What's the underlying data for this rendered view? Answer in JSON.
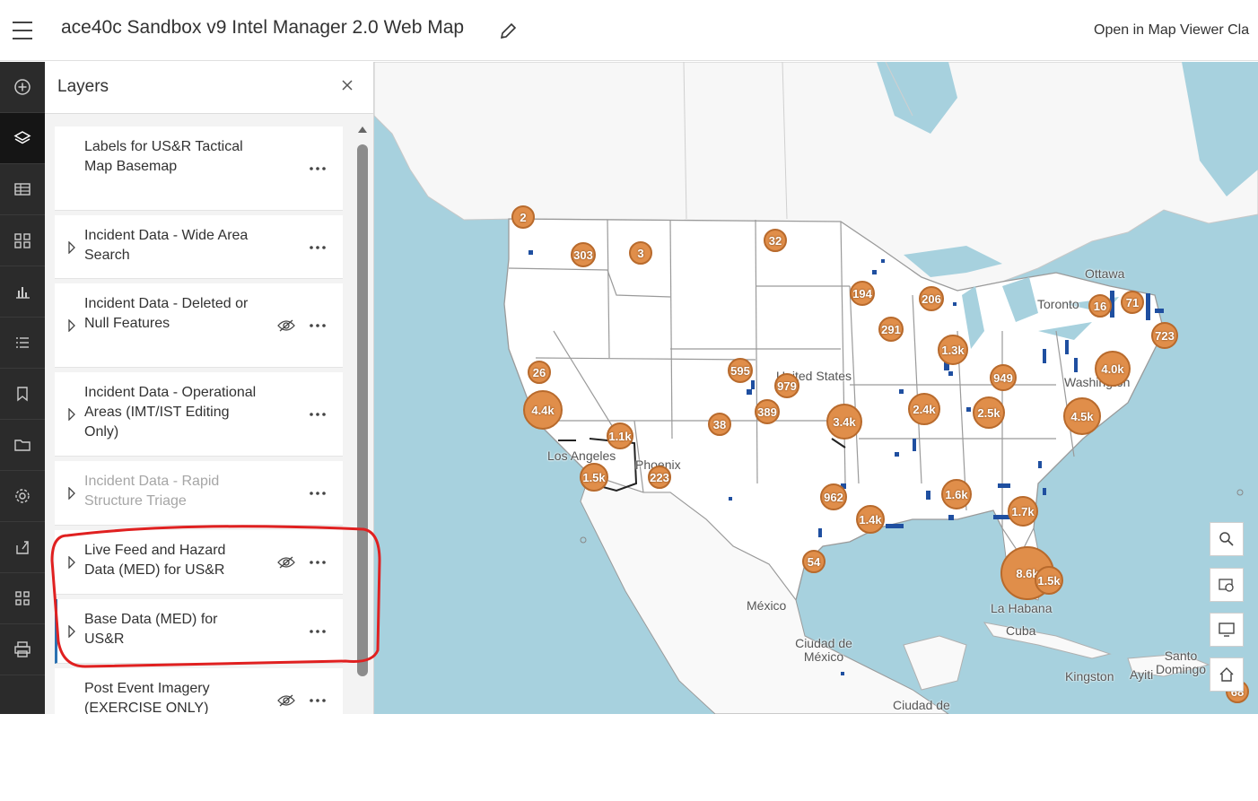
{
  "header": {
    "title": "ace40c Sandbox v9 Intel Manager 2.0 Web Map",
    "open_in_viewer": "Open in Map Viewer Cla"
  },
  "rail": {
    "items": [
      {
        "icon": "add-icon"
      },
      {
        "icon": "layers-icon",
        "active": true
      },
      {
        "icon": "table-icon"
      },
      {
        "icon": "widgets-icon"
      },
      {
        "icon": "chart-icon"
      },
      {
        "icon": "list-icon"
      },
      {
        "icon": "bookmark-icon"
      },
      {
        "icon": "folder-icon"
      },
      {
        "icon": "gear-icon"
      },
      {
        "icon": "share-icon"
      },
      {
        "icon": "apps-icon"
      },
      {
        "icon": "print-icon"
      }
    ]
  },
  "panel": {
    "title": "Layers",
    "layers": [
      {
        "label": "Labels for US&R Tactical Map Basemap",
        "expandable": false,
        "hidden": false
      },
      {
        "label": "Incident Data - Wide Area Search",
        "expandable": true,
        "hidden": false
      },
      {
        "label": "Incident Data - Deleted or Null Features",
        "expandable": true,
        "hidden": true
      },
      {
        "label": "Incident Data - Operational Areas (IMT/IST Editing Only)",
        "expandable": true,
        "hidden": false
      },
      {
        "label": "Incident Data - Rapid Structure Triage",
        "expandable": true,
        "hidden": false,
        "dim": true
      },
      {
        "label": "Live Feed and Hazard Data (MED) for US&R",
        "expandable": true,
        "hidden": true
      },
      {
        "label": "Base Data (MED) for US&R",
        "expandable": true,
        "hidden": false,
        "selected": true
      },
      {
        "label": "Post Event Imagery (EXERCISE ONLY)",
        "expandable": false,
        "hidden": true
      }
    ]
  },
  "map": {
    "labels": {
      "us": "United States",
      "la": "Los Angeles",
      "phoenix": "Phoenix",
      "washington": "Washington",
      "toronto": "Toronto",
      "ottawa": "Ottawa",
      "mexico": "México",
      "cdmx": "Ciudad de México",
      "habana": "La Habana",
      "cuba": "Cuba",
      "kingston": "Kingston",
      "santo": "Santo Domingo",
      "ayiti": "Ayiti",
      "ciudad2": "Ciudad de"
    },
    "clusters": [
      {
        "label": "2"
      },
      {
        "label": "303"
      },
      {
        "label": "3"
      },
      {
        "label": "32"
      },
      {
        "label": "194"
      },
      {
        "label": "206"
      },
      {
        "label": "16"
      },
      {
        "label": "71"
      },
      {
        "label": "723"
      },
      {
        "label": "291"
      },
      {
        "label": "1.3k"
      },
      {
        "label": "26"
      },
      {
        "label": "595"
      },
      {
        "label": "979"
      },
      {
        "label": "4.0k"
      },
      {
        "label": "949"
      },
      {
        "label": "4.4k"
      },
      {
        "label": "389"
      },
      {
        "label": "3.4k"
      },
      {
        "label": "2.4k"
      },
      {
        "label": "2.5k"
      },
      {
        "label": "4.5k"
      },
      {
        "label": "38"
      },
      {
        "label": "1.1k"
      },
      {
        "label": "1.5k"
      },
      {
        "label": "223"
      },
      {
        "label": "962"
      },
      {
        "label": "1.6k"
      },
      {
        "label": "1.7k"
      },
      {
        "label": "1.4k"
      },
      {
        "label": "54"
      },
      {
        "label": "8.6k"
      },
      {
        "label": "1.5k"
      },
      {
        "label": "68"
      }
    ]
  }
}
